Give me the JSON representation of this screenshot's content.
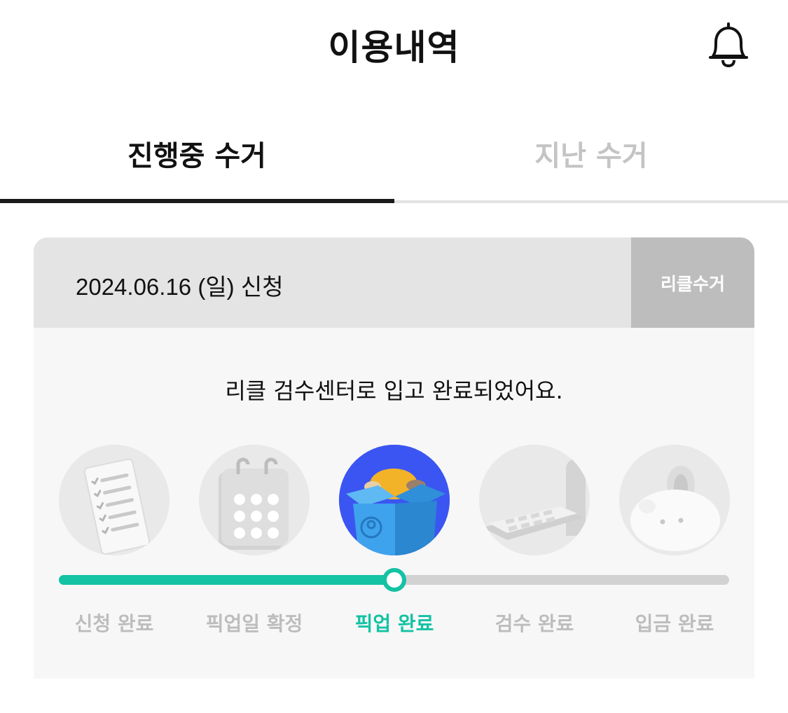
{
  "header": {
    "title": "이용내역",
    "bell_icon": "bell-icon"
  },
  "tabs": [
    {
      "label": "진행중 수거",
      "active": true
    },
    {
      "label": "지난 수거",
      "active": false
    }
  ],
  "card": {
    "date_label": "2024.06.16 (일) 신청",
    "brand_button": "리클수거",
    "status_message": "리클 검수센터로 입고 완료되었어요.",
    "progress_fraction": 0.5,
    "current_step_index": 2,
    "steps": [
      {
        "label": "신청 완료",
        "icon": "checklist-icon"
      },
      {
        "label": "픽업일 확정",
        "icon": "calendar-icon"
      },
      {
        "label": "픽업 완료",
        "icon": "box-icon"
      },
      {
        "label": "검수 완료",
        "icon": "scale-icon"
      },
      {
        "label": "입금 완료",
        "icon": "piggy-bank-icon"
      }
    ]
  },
  "colors": {
    "accent": "#14c2a4",
    "active_step_bg": "#3b55f2",
    "inactive": "#bdbdbd"
  }
}
